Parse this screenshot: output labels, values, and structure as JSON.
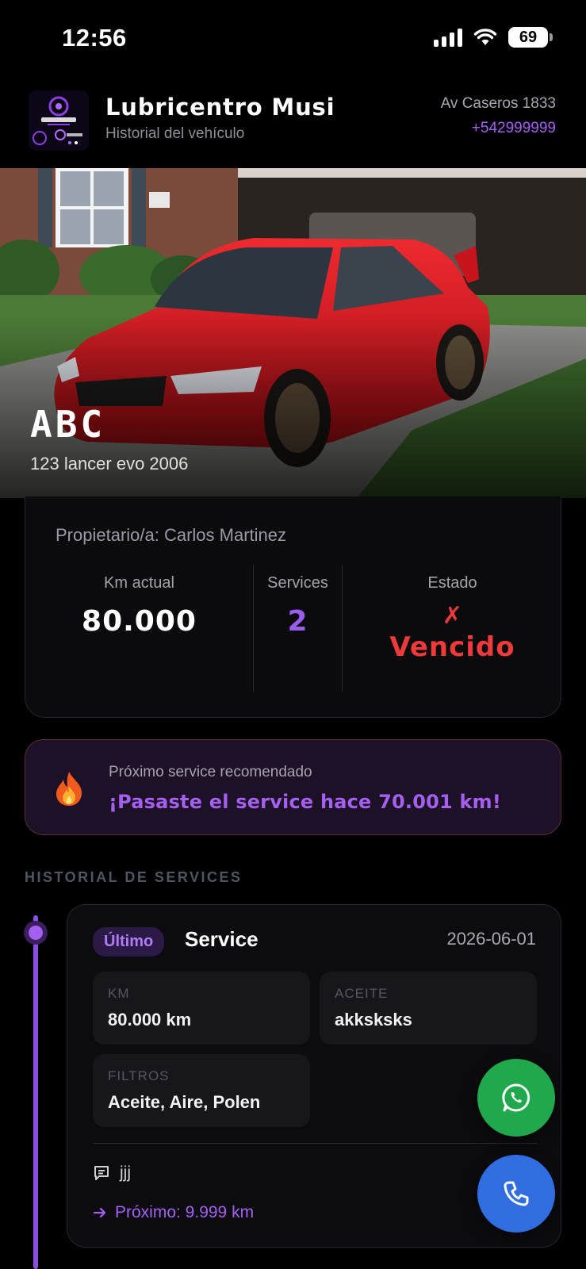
{
  "status_bar": {
    "time": "12:56",
    "battery": "69"
  },
  "header": {
    "logo_icon": "taller-logo-icon",
    "brand_name": "Lubricentro Musi",
    "subtitle": "Historial del vehículo",
    "address": "Av Caseros 1833",
    "phone": "+542999999"
  },
  "hero": {
    "plate": "ABC",
    "model": "123 lancer evo 2006",
    "car_color": "#d8141c"
  },
  "info": {
    "owner": "Propietario/a: Carlos Martinez",
    "km_label": "Km actual",
    "km_value": "80.000",
    "services_label": "Services",
    "services_value": "2",
    "estado_label": "Estado",
    "estado_mark": "✗",
    "estado_value": "Vencido"
  },
  "alert": {
    "icon": "fire-icon",
    "title": "Próximo service recomendado",
    "message": "¡Pasaste el service hace 70.001 km!"
  },
  "history": {
    "title": "HISTORIAL DE SERVICES",
    "services": [
      {
        "badge": "Último",
        "title": "Service",
        "date": "2026-06-01",
        "km_label": "KM",
        "km_value": "80.000 km",
        "aceite_label": "ACEITE",
        "aceite_value": "akksksks",
        "filtros_label": "FILTROS",
        "filtros_value": "Aceite, Aire, Polen",
        "note": "jjj",
        "next": "Próximo: 9.999 km"
      }
    ]
  },
  "actions": {
    "whatsapp_icon": "whatsapp-icon",
    "call_icon": "phone-icon"
  },
  "colors": {
    "accent": "#a461ee",
    "danger": "#ee3a3a",
    "whatsapp": "#1fa84c",
    "call": "#2f6de0"
  }
}
